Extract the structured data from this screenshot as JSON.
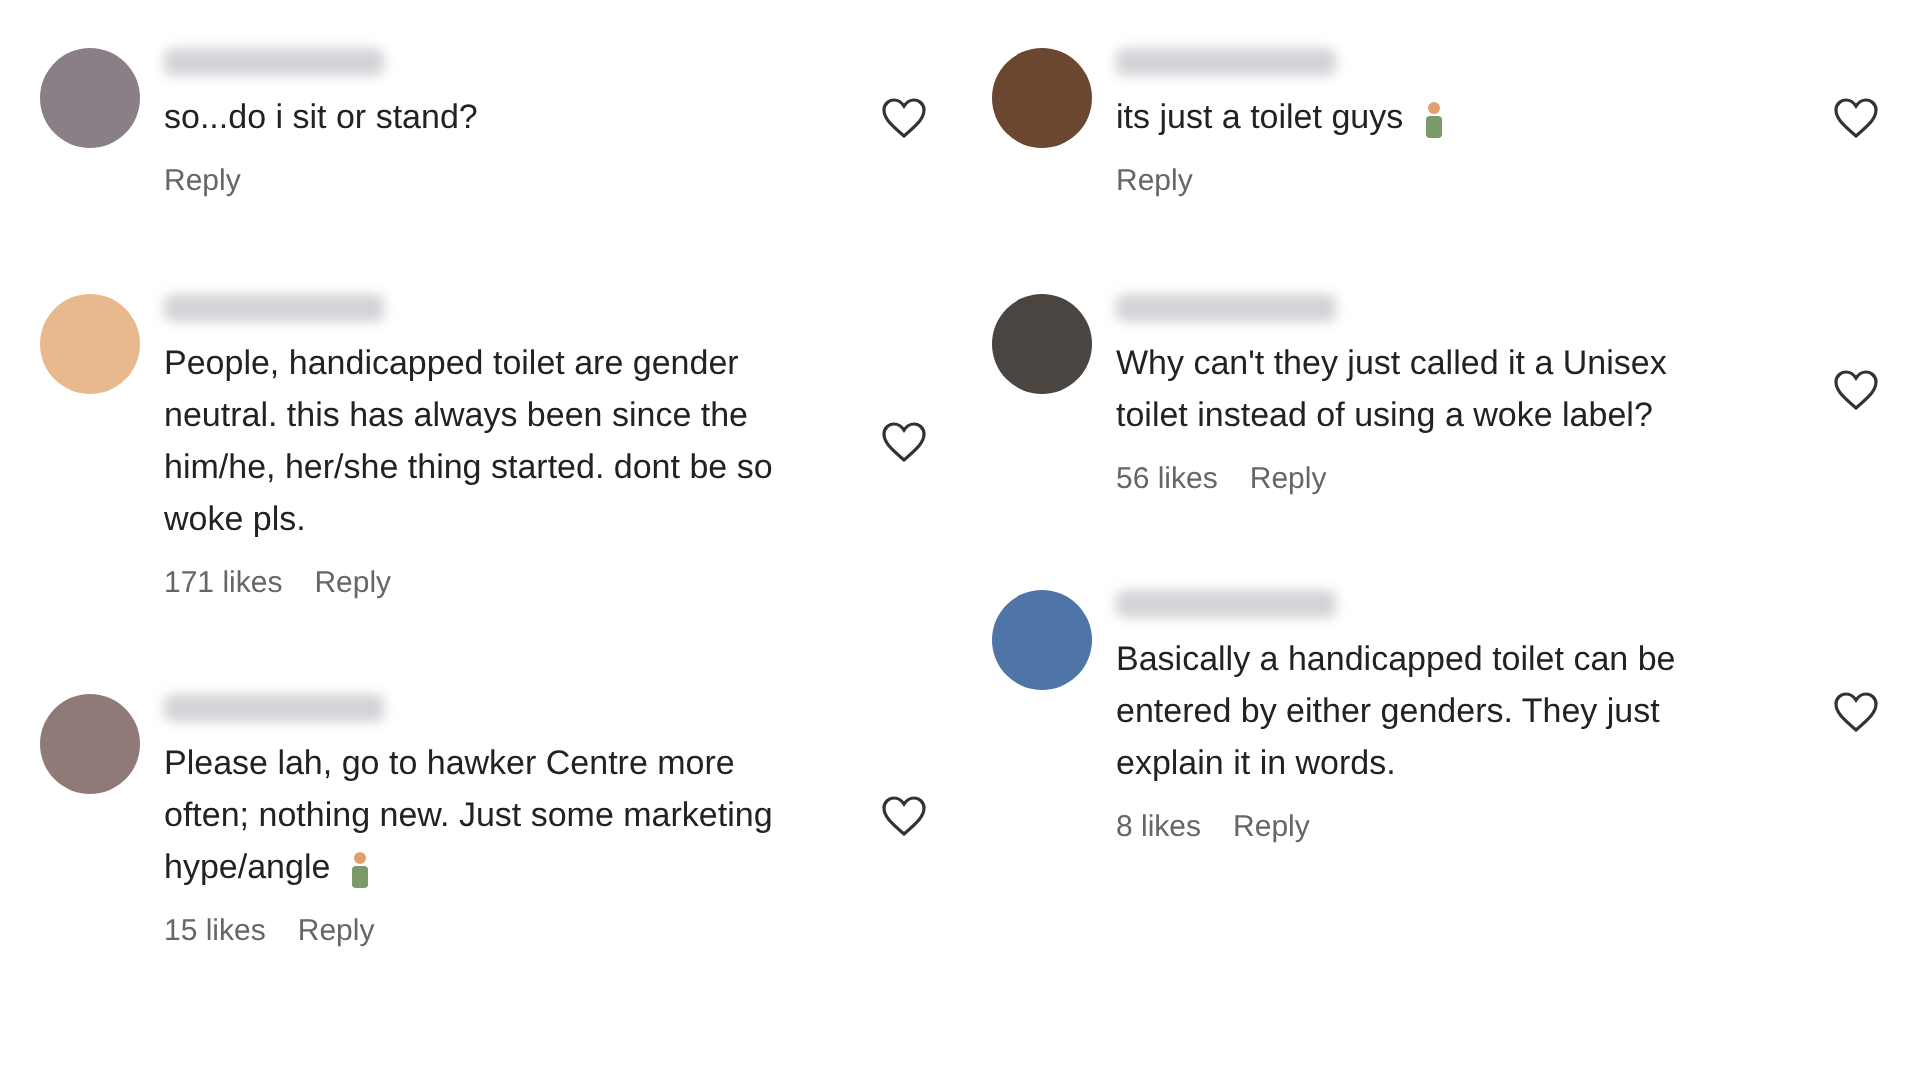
{
  "columns": [
    {
      "comments": [
        {
          "text": "so...do i sit or stand?",
          "reply": "Reply",
          "color": "#8a7f86",
          "emoji": false
        },
        {
          "text": "People, handicapped toilet are gender neutral. this has always been since the him/he, her/she thing started. dont be so woke pls.",
          "likes": "171 likes",
          "reply": "Reply",
          "color": "#e8b98c",
          "emoji": false
        },
        {
          "text": "Please lah, go to hawker Centre more often; nothing new. Just some marketing hype/angle",
          "likes": "15 likes",
          "reply": "Reply",
          "color": "#8f7a78",
          "emoji": true
        }
      ]
    },
    {
      "comments": [
        {
          "text": "its just a toilet guys",
          "reply": "Reply",
          "color": "#6b4630",
          "emoji": true
        },
        {
          "text": "Why can't they just called it a Unisex toilet instead of using a woke label?",
          "likes": "56 likes",
          "reply": "Reply",
          "color": "#4a4540",
          "emoji": false
        },
        {
          "text": "Basically a handicapped toilet can be entered by either genders. They just explain it in words.",
          "likes": "8 likes",
          "reply": "Reply",
          "color": "#4f74a8",
          "emoji": false
        }
      ]
    }
  ]
}
